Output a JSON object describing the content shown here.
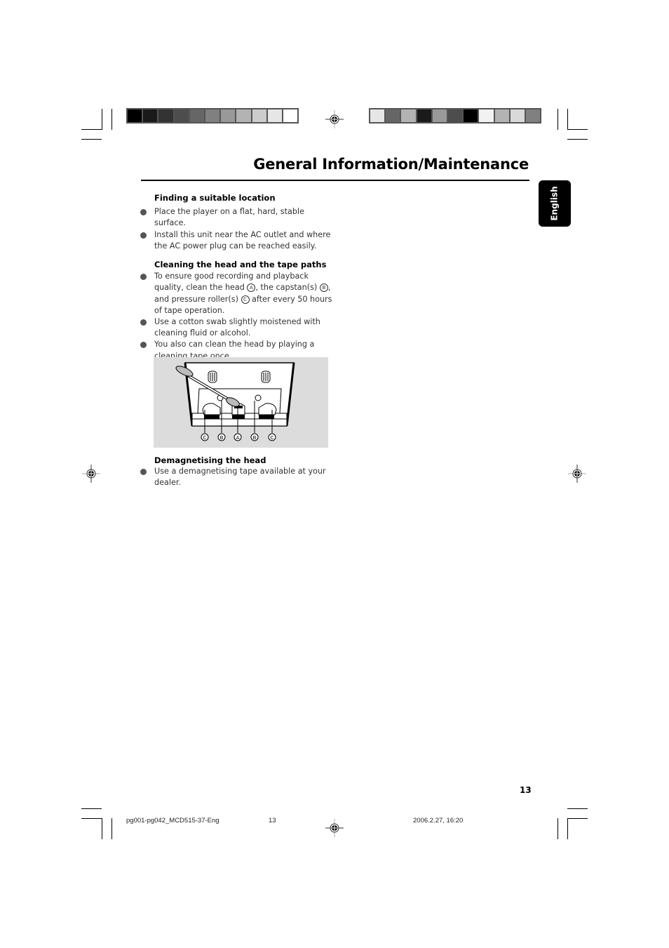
{
  "header": {
    "title": "General Information/Maintenance",
    "language_tab": "English"
  },
  "color_bars": {
    "left": [
      "#000000",
      "#1a1a1a",
      "#333333",
      "#4d4d4d",
      "#666666",
      "#808080",
      "#999999",
      "#b3b3b3",
      "#cccccc",
      "#e6e6e6",
      "#ffffff"
    ],
    "right": [
      "#e6e6e6",
      "#666666",
      "#b3b3b3",
      "#1a1a1a",
      "#999999",
      "#4d4d4d",
      "#000000",
      "#f2f2f2",
      "#b3b3b3",
      "#d9d9d9",
      "#808080"
    ]
  },
  "sections": [
    {
      "heading": "Finding a suitable location",
      "bullets": [
        "Place the player on a flat, hard, stable surface.",
        "Install this unit near the AC outlet and where the AC power plug can be reached easily."
      ]
    },
    {
      "heading": "Cleaning the head and the tape paths",
      "bullets": [
        {
          "parts": [
            "To ensure good recording and playback quality, clean the head ",
            "A",
            ", the capstan(s) ",
            "B",
            ", and pressure roller(s) ",
            "C",
            " after every 50 hours of tape operation."
          ]
        },
        "Use a cotton swab slightly moistened with cleaning fluid or alcohol.",
        "You also can clean the head  by playing a cleaning tape once."
      ]
    },
    {
      "heading": "Demagnetising the head",
      "bullets": [
        "Use a demagnetising tape available at your dealer."
      ]
    }
  ],
  "figure": {
    "labels": [
      "C",
      "B",
      "A",
      "B",
      "C"
    ]
  },
  "page_number": "13",
  "footer": {
    "file": "pg001-pg042_MCD515-37-Eng",
    "page": "13",
    "timestamp": "2006.2.27, 16:20"
  }
}
